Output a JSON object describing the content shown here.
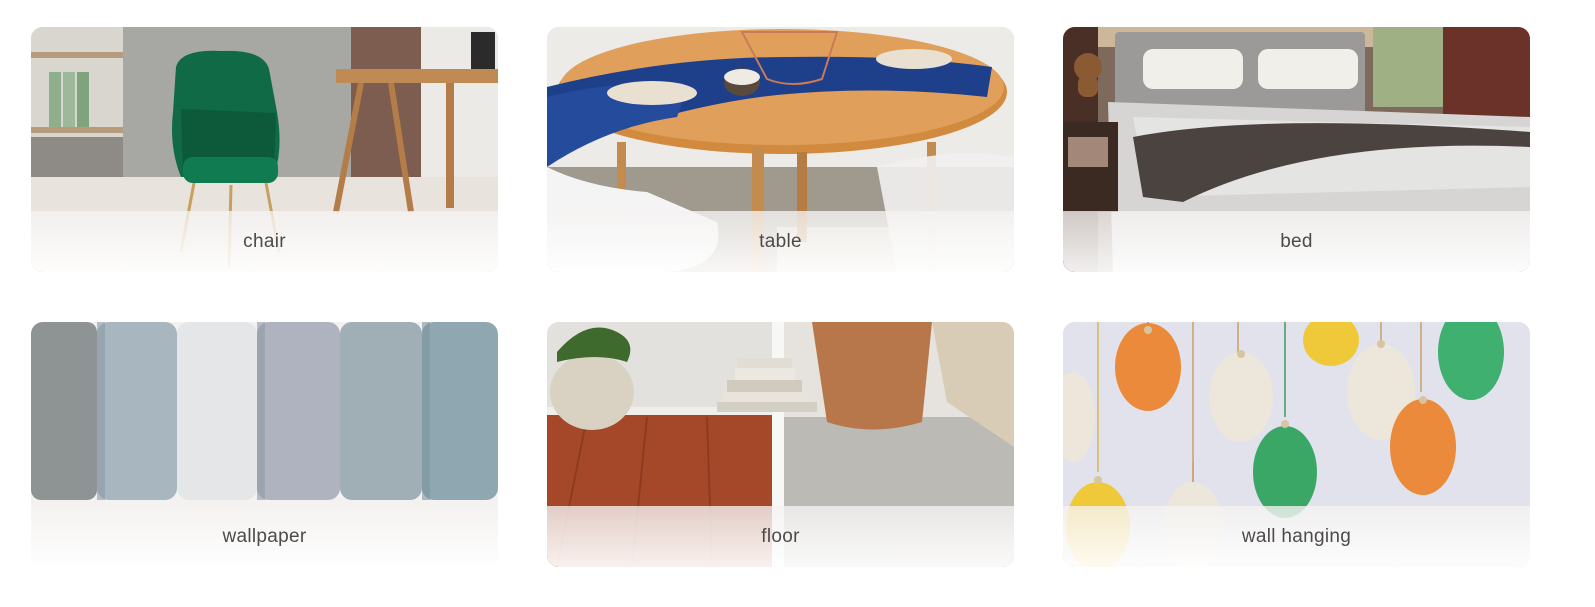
{
  "categories": [
    {
      "label": "chair",
      "image": "green-velvet-chair-photo"
    },
    {
      "label": "table",
      "image": "round-wood-dining-table-photo"
    },
    {
      "label": "bed",
      "image": "bedroom-bed-photo"
    },
    {
      "label": "wallpaper",
      "image": "wallpaper-rolls-photo"
    },
    {
      "label": "floor",
      "image": "wood-and-carpet-floor-photo"
    },
    {
      "label": "wall hanging",
      "image": "macrame-feather-wall-hanging-photo"
    }
  ]
}
